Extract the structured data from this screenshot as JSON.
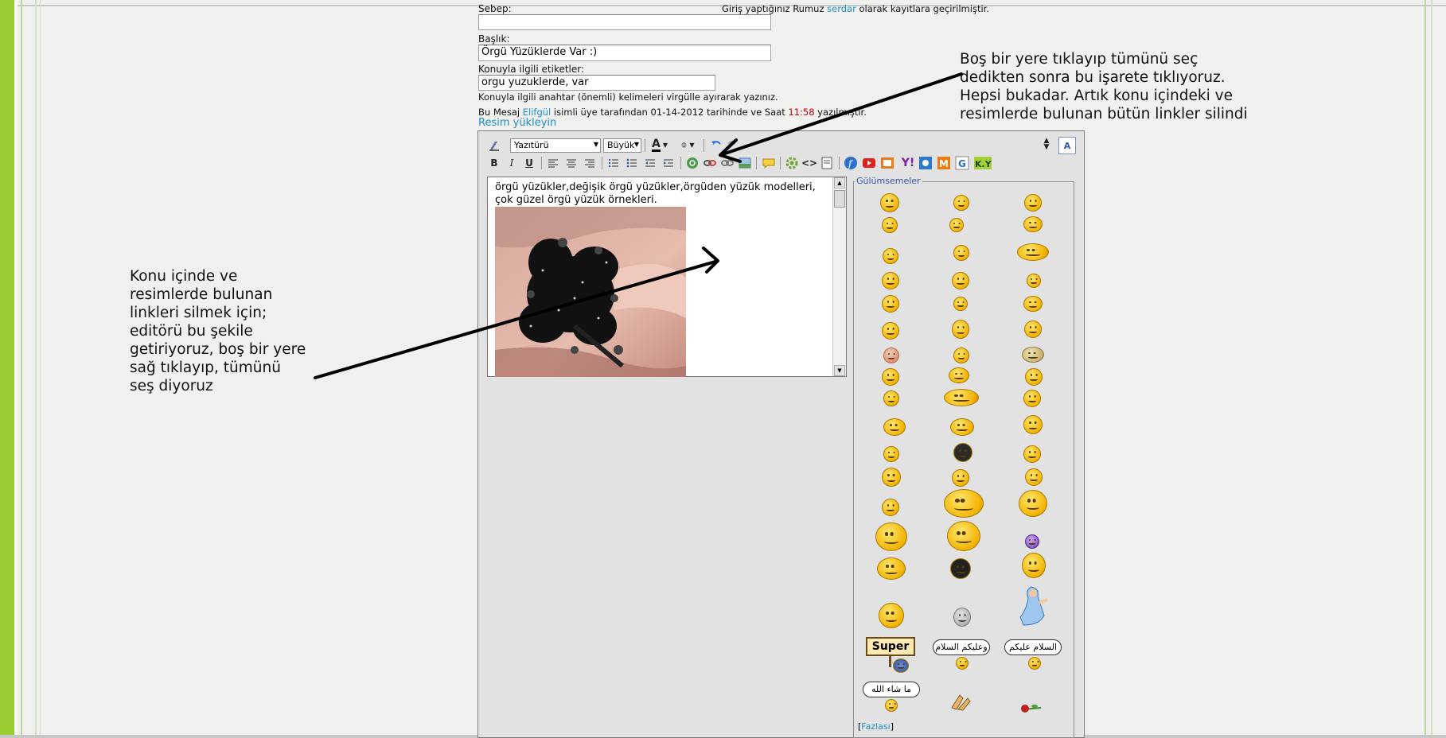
{
  "form": {
    "reason_label": "Sebep:",
    "reason_value": "",
    "nick_notice_prefix": "Giriş yaptığınız Rumuz ",
    "nick_name": "serdar",
    "nick_notice_suffix": " olarak kayıtlara geçirilmiştir.",
    "title_label": "Başlık:",
    "title_value": "Örgü Yüzüklerde Var :)",
    "tags_label": "Konuyla ilgili etiketler:",
    "tags_value": "orgu yuzuklerde, var",
    "tags_hint": "Konuyla ilgili anahtar (önemli) kelimeleri virgülle ayırarak yazınız.",
    "edit_prefix": "Bu Mesaj ",
    "edit_user": "Elifgül",
    "edit_middle": " isimli üye tarafından 01-14-2012 tarihinde ve Saat ",
    "edit_time": "11:58",
    "edit_suffix": " yazılmıştır.",
    "upload_link": "Resim yükleyin"
  },
  "editor": {
    "font_select": "Yazıtürü",
    "size_select": "Büyük",
    "content_text": "örgü yüzükler,değişik örgü yüzükler,örgüden yüzük modelleri, çok güzel örgü yüzük örnekleri.",
    "toolbar": {
      "bold": "B",
      "italic": "I",
      "underline": "U",
      "text_color": "A",
      "code": "<>"
    }
  },
  "smilies": {
    "title": "Gülümsemeler",
    "more_link": "Fazlası",
    "super_sign": "Super",
    "arabic_1": "وعليكم السلام",
    "arabic_2": "السلام عليكم",
    "arabic_3": "ما شاء الله"
  },
  "annotations": {
    "right_note": [
      "Boş bir yere tıklayıp tümünü seç",
      "dedikten sonra bu işarete tıklıyoruz.",
      "Hepsi bukadar. Artık konu içindeki ve",
      "resimlerde bulunan bütün linkler silindi"
    ],
    "left_note": [
      "Konu içinde ve",
      "resimlerde bulunan",
      "linkleri silmek için;",
      "editörü bu şekile",
      "getiriyoruz, boş bir yere",
      "sağ tıklayıp, tümünü",
      "seş diyoruz"
    ]
  },
  "colors": {
    "accent_green": "#9ACD32",
    "link_blue": "#1e90c8",
    "time_red": "#c00000"
  }
}
